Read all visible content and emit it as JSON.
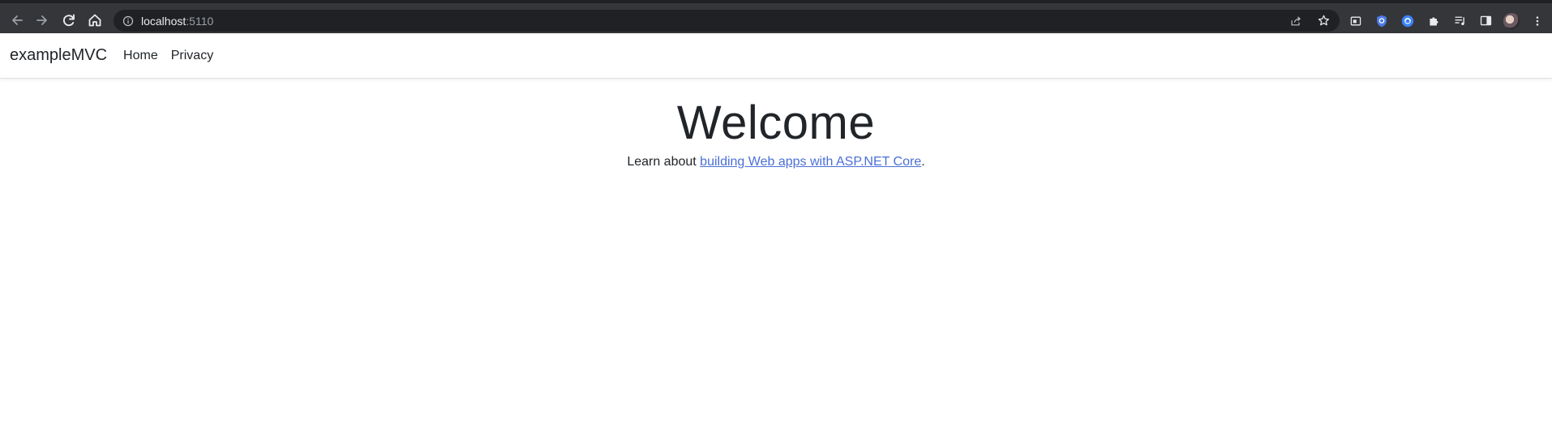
{
  "browser": {
    "url_host": "localhost",
    "url_port": ":5110",
    "icons": {
      "back": "back-arrow-icon",
      "forward": "forward-arrow-icon",
      "reload": "reload-icon",
      "home": "home-icon",
      "site_info": "info-icon",
      "share": "share-icon",
      "bookmark": "star-icon",
      "extensions": [
        "tab-search-icon",
        "shield-extension-icon",
        "blue-extension-icon",
        "puzzle-icon",
        "reading-list-icon",
        "side-panel-icon"
      ],
      "profile": "avatar",
      "menu": "kebab-menu-icon"
    },
    "colors": {
      "toolbar": "#35363a",
      "omnibox": "#202124"
    }
  },
  "navbar": {
    "brand": "exampleMVC",
    "links": [
      {
        "label": "Home"
      },
      {
        "label": "Privacy"
      }
    ]
  },
  "main": {
    "title": "Welcome",
    "lead_prefix": "Learn about ",
    "lead_link": "building Web apps with ASP.NET Core",
    "lead_suffix": "."
  },
  "colors": {
    "link": "#4a6fd6",
    "text": "#212529"
  }
}
